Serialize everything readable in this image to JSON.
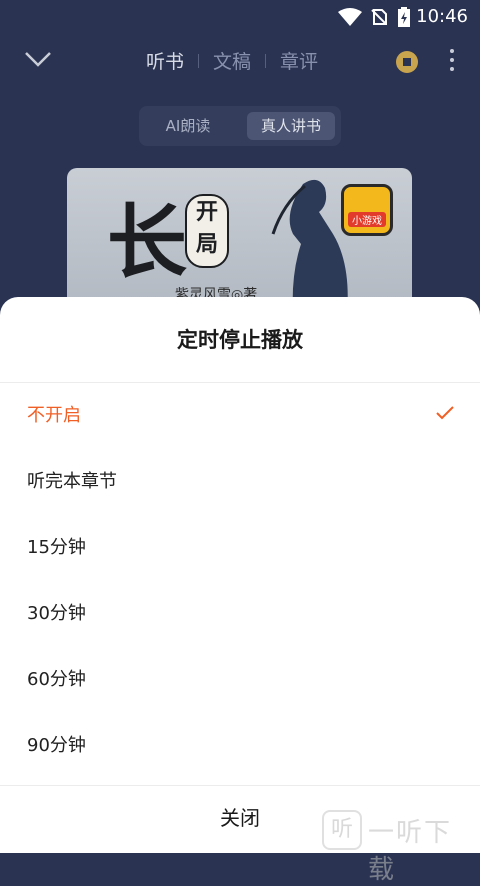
{
  "status_bar": {
    "time": "10:46"
  },
  "header": {
    "tabs": [
      {
        "label": "听书"
      },
      {
        "label": "文稿"
      },
      {
        "label": "章评"
      }
    ]
  },
  "voice_toggle": {
    "options": [
      "AI朗读",
      "真人讲书"
    ],
    "selected": "真人讲书"
  },
  "cover": {
    "title_main": "长",
    "title_small": "开局",
    "author": "紫灵风雪◎著",
    "badge": "小游戏"
  },
  "sheet": {
    "title": "定时停止播放",
    "options": [
      {
        "label": "不开启",
        "selected": true
      },
      {
        "label": "听完本章节",
        "selected": false
      },
      {
        "label": "15分钟",
        "selected": false
      },
      {
        "label": "30分钟",
        "selected": false
      },
      {
        "label": "60分钟",
        "selected": false
      },
      {
        "label": "90分钟",
        "selected": false
      }
    ],
    "close_label": "关闭"
  },
  "watermark": {
    "icon_text": "听",
    "text": "一听下载"
  },
  "colors": {
    "accent": "#f05f25",
    "background": "#2a3452"
  }
}
